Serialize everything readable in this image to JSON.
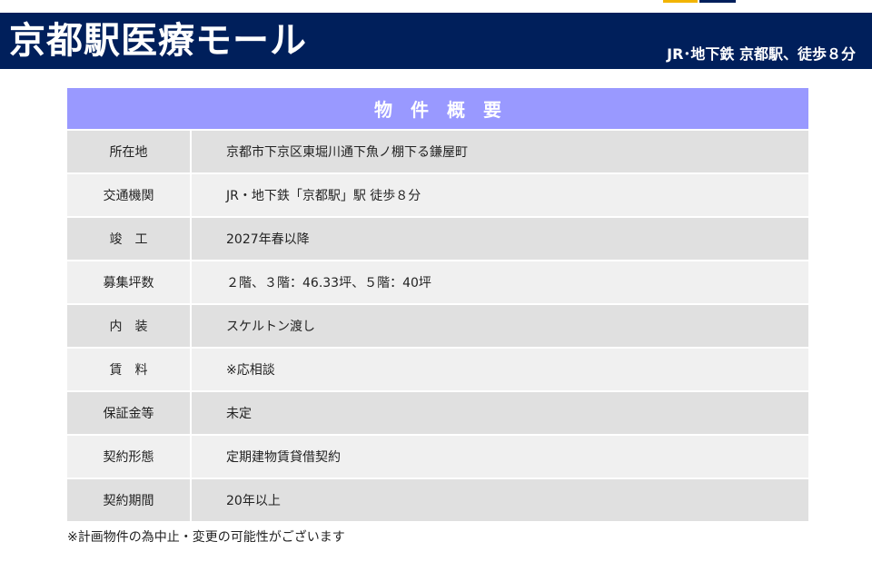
{
  "header": {
    "title": "京都駅医療モール",
    "access": "JR･地下鉄 京都駅、徒歩８分"
  },
  "table": {
    "title": "物件概要",
    "rows": [
      {
        "label": "所在地",
        "value": "京都市下京区東堀川通下魚ノ棚下る鎌屋町"
      },
      {
        "label": "交通機関",
        "value": "JR・地下鉄「京都駅」駅 徒歩８分"
      },
      {
        "label": "竣　工",
        "value": "2027年春以降"
      },
      {
        "label": "募集坪数",
        "value": "２階、３階：46.33坪、５階：40坪"
      },
      {
        "label": "内　装",
        "value": "スケルトン渡し"
      },
      {
        "label": "賃　料",
        "value": "※応相談"
      },
      {
        "label": "保証金等",
        "value": "未定"
      },
      {
        "label": "契約形態",
        "value": "定期建物賃貸借契約"
      },
      {
        "label": "契約期間",
        "value": "20年以上"
      }
    ]
  },
  "footnote": "※計画物件の為中止・変更の可能性がございます",
  "colors": {
    "header_bg": "#001f5b",
    "table_title_bg": "#9999ff",
    "row_dark": "#e0e0e0",
    "row_light": "#f0f0f0",
    "accent_gold": "#f2b400"
  }
}
